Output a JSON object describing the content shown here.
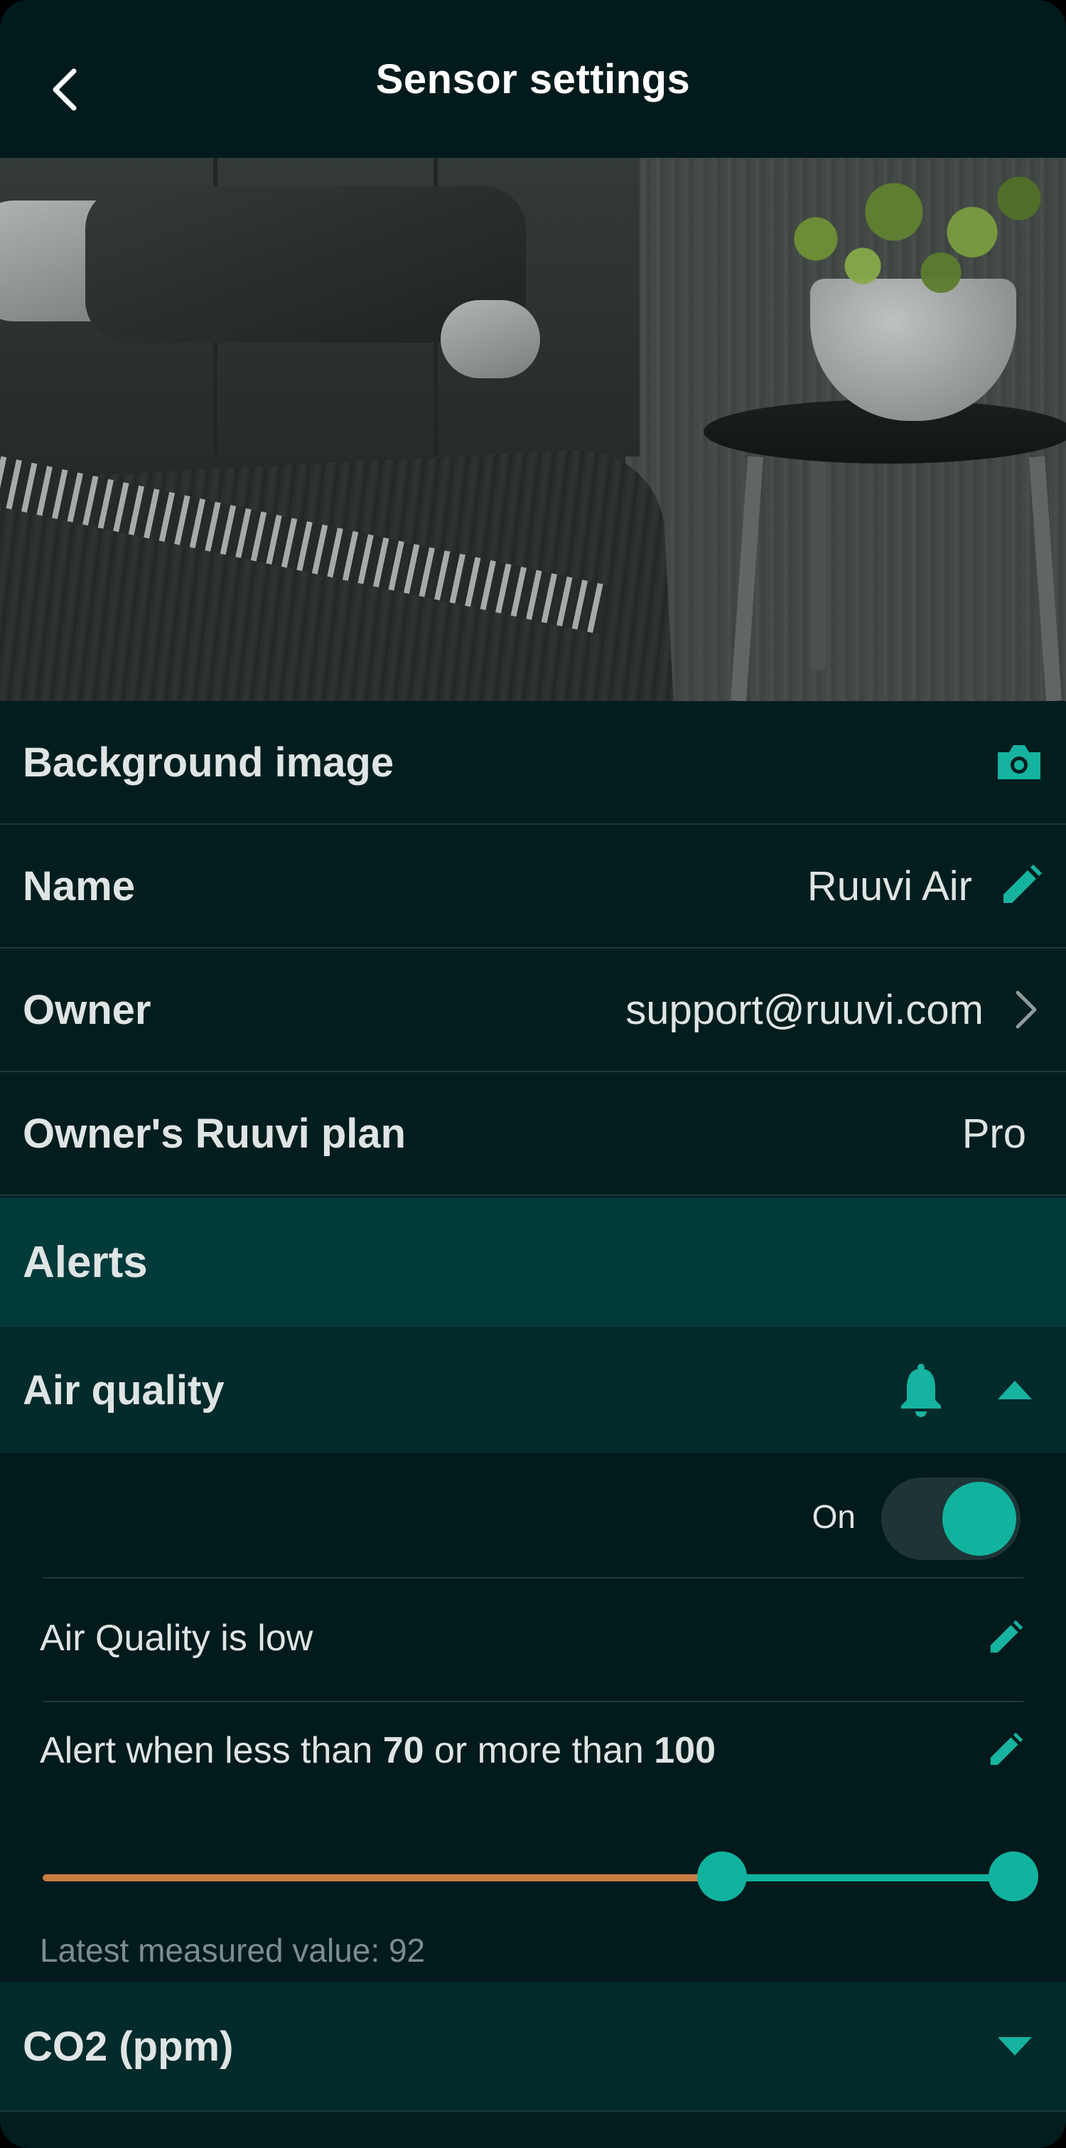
{
  "header": {
    "title": "Sensor settings"
  },
  "rows": {
    "background": {
      "label": "Background image"
    },
    "name": {
      "label": "Name",
      "value": "Ruuvi Air"
    },
    "owner": {
      "label": "Owner",
      "value": "support@ruuvi.com"
    },
    "plan": {
      "label": "Owner's Ruuvi plan",
      "value": "Pro"
    }
  },
  "alerts": {
    "title": "Alerts",
    "air_quality": {
      "label": "Air quality",
      "toggle_label": "On",
      "enabled": true,
      "description": "Air Quality is low",
      "condition_prefix": "Alert when less than ",
      "min": "70",
      "condition_mid": " or more than ",
      "max": "100",
      "slider": {
        "scale_min": 0,
        "scale_max": 100,
        "low": 70,
        "high": 100
      },
      "latest": "Latest measured value: 92"
    },
    "co2": {
      "label": "CO2 (ppm)"
    }
  },
  "colors": {
    "accent": "#11b39f",
    "below_range": "#c87d45",
    "background": "#011d1d",
    "section_header": "#013a3b"
  },
  "icons": [
    "back-icon",
    "camera-icon",
    "pencil-icon",
    "chevron-right-icon",
    "bell-icon",
    "caret-up-icon",
    "caret-down-icon"
  ]
}
